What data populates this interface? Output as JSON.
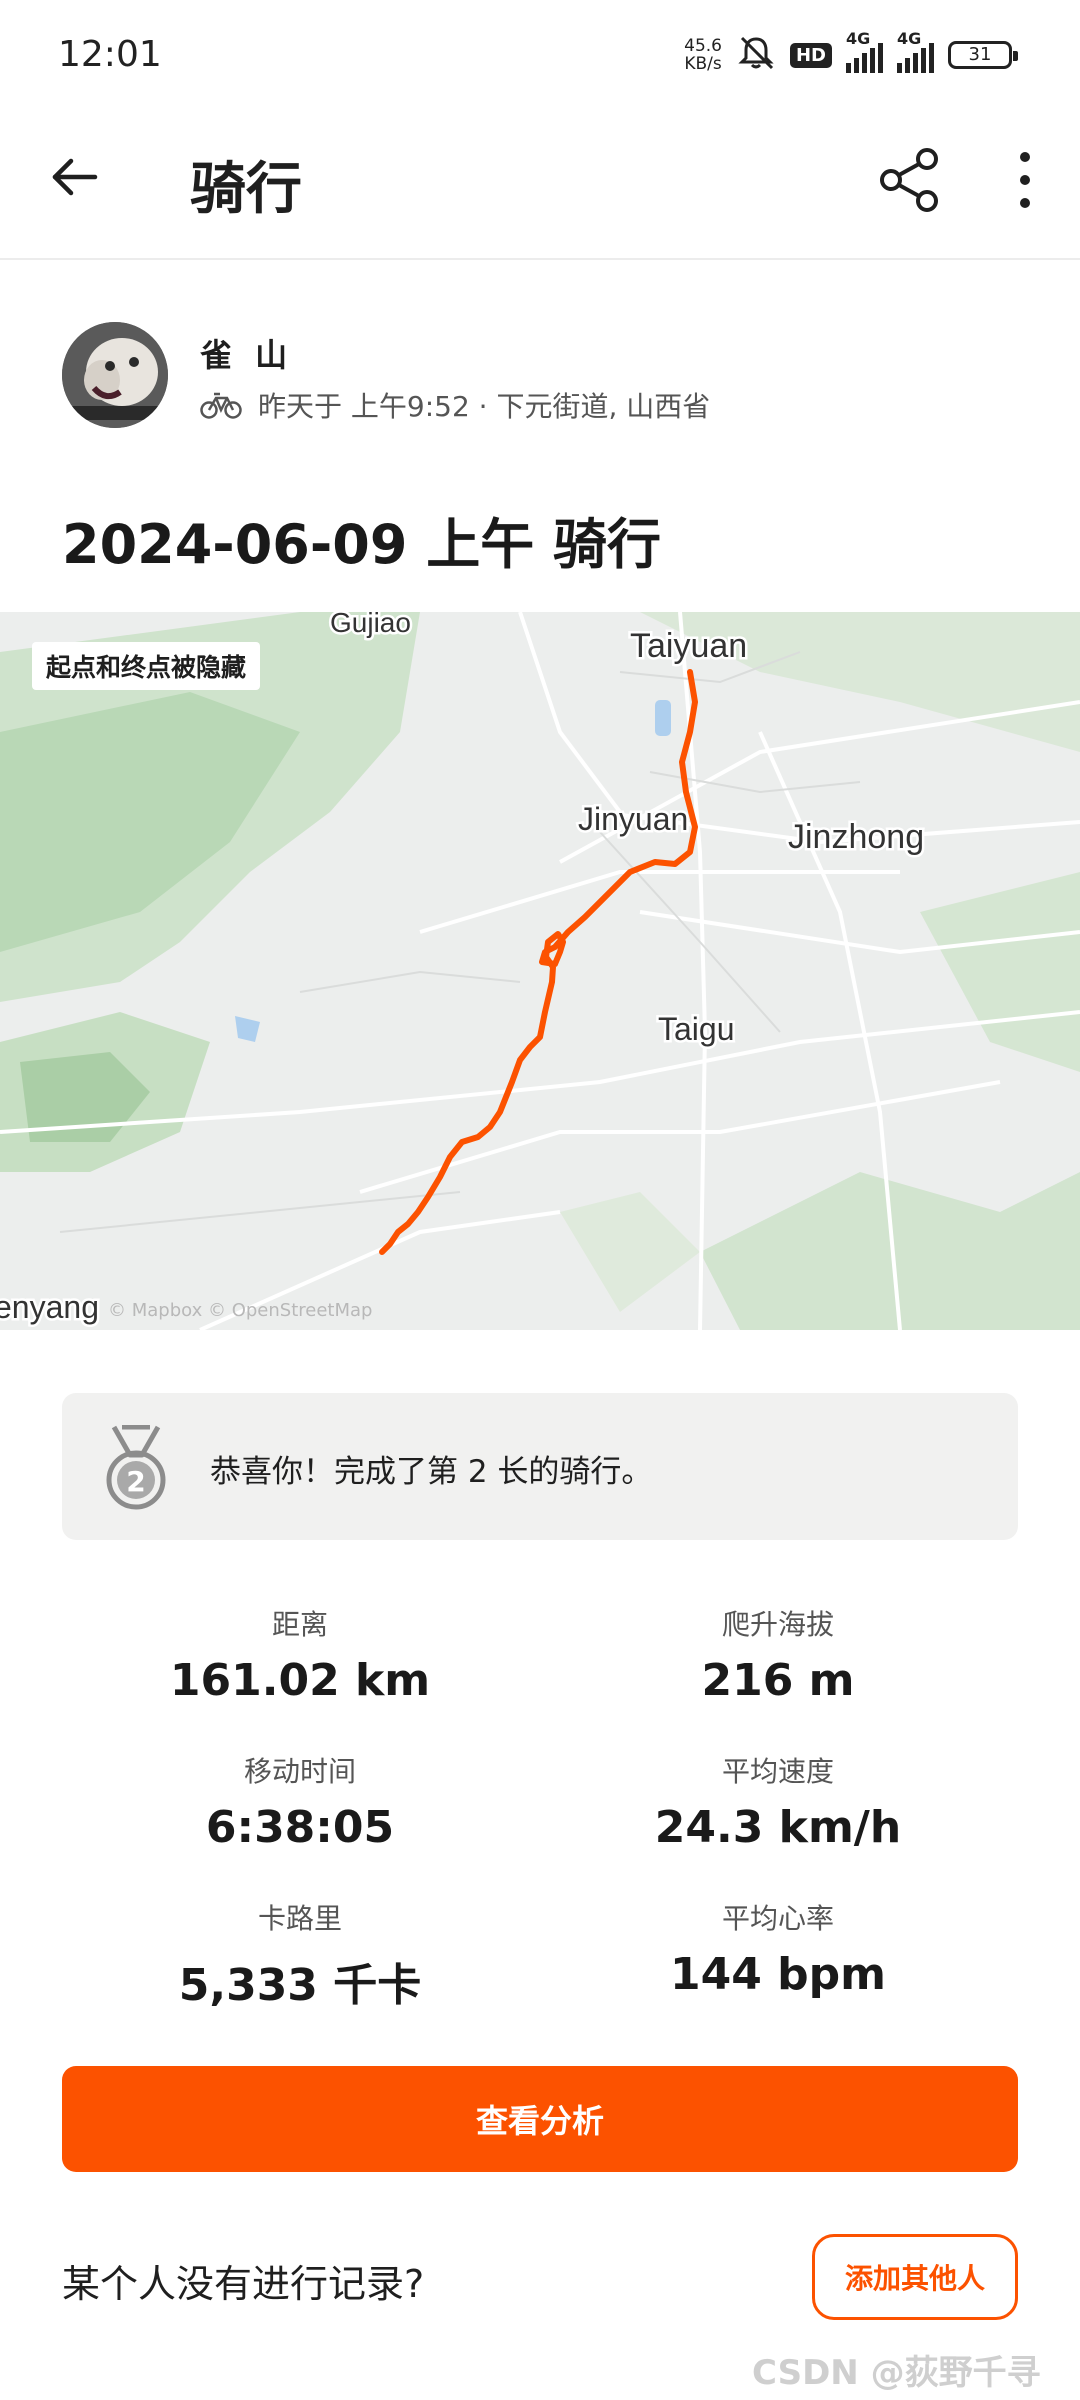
{
  "status_bar": {
    "time": "12:01",
    "net_speed_value": "45.6",
    "net_speed_unit": "KB/s",
    "hd_label": "HD",
    "network_1": "4G",
    "network_2": "4G",
    "battery": "31",
    "icons": [
      "mute-icon",
      "signal-icon",
      "battery-icon"
    ]
  },
  "app_bar": {
    "title": "骑行",
    "icons": [
      "back-arrow-icon",
      "share-icon",
      "more-vertical-icon"
    ]
  },
  "athlete": {
    "name": "雀 山",
    "meta": "昨天于 上午9:52 · 下元街道, 山西省",
    "activity_icon": "bicycle-icon"
  },
  "activity": {
    "title": "2024-06-09 上午 骑行"
  },
  "map": {
    "hidden_label": "起点和终点被隐藏",
    "places": [
      "Gujiao",
      "Taiyuan",
      "Jinyuan",
      "Jinzhong",
      "Taigu",
      "enyang"
    ],
    "attribution": "© Mapbox © OpenStreetMap",
    "route_color": "#fc5200"
  },
  "achievement": {
    "text": "恭喜你！完成了第 2 长的骑行。",
    "medal_rank": "2",
    "icon": "medal-icon"
  },
  "stats": [
    {
      "label": "距离",
      "value": "161.02 km"
    },
    {
      "label": "爬升海拔",
      "value": "216 m"
    },
    {
      "label": "移动时间",
      "value": "6:38:05"
    },
    {
      "label": "平均速度",
      "value": "24.3 km/h"
    },
    {
      "label": "卡路里",
      "value": "5,333 千卡"
    },
    {
      "label": "平均心率",
      "value": "144 bpm"
    }
  ],
  "buttons": {
    "analysis": "查看分析",
    "add_others": "添加其他人"
  },
  "missing_record_prompt": "某个人没有进行记录?",
  "watermark": "CSDN @荻野千寻",
  "colors": {
    "brand": "#fc5200",
    "card_bg": "#f1f1f0"
  }
}
